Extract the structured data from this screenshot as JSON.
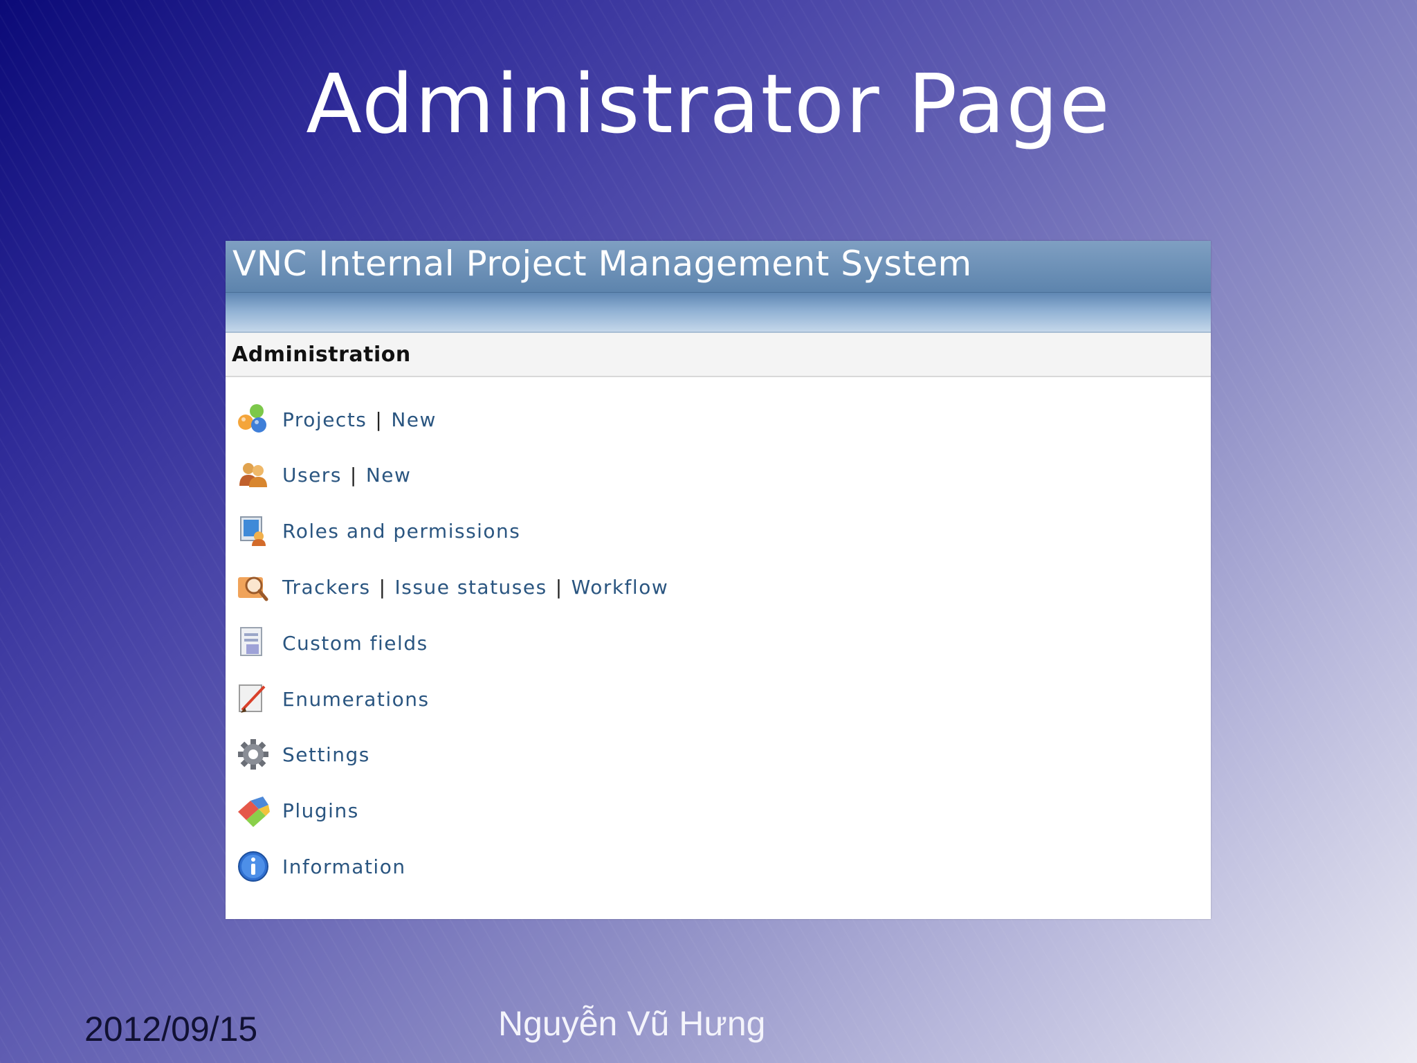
{
  "slide": {
    "title": "Administrator Page",
    "date": "2012/09/15",
    "author": "Nguyễn Vũ Hưng"
  },
  "app": {
    "title": "VNC Internal Project Management System",
    "section_title": "Administration"
  },
  "menu": {
    "projects": {
      "icon": "projects-icon",
      "label": "Projects",
      "new_label": "New"
    },
    "users": {
      "icon": "users-icon",
      "label": "Users",
      "new_label": "New"
    },
    "roles": {
      "icon": "roles-icon",
      "label": "Roles and permissions"
    },
    "trackers": {
      "icon": "trackers-icon",
      "label": "Trackers",
      "issue_statuses": "Issue statuses",
      "workflow": "Workflow"
    },
    "custom_fields": {
      "icon": "custom-fields-icon",
      "label": "Custom fields"
    },
    "enumerations": {
      "icon": "enumerations-icon",
      "label": "Enumerations"
    },
    "settings": {
      "icon": "gear-icon",
      "label": "Settings"
    },
    "plugins": {
      "icon": "plugins-icon",
      "label": "Plugins"
    },
    "information": {
      "icon": "info-icon",
      "label": "Information"
    }
  },
  "colors": {
    "link": "#2a5580",
    "header": "#5d84ad",
    "background_start": "#0b0a78",
    "background_end": "#ececf4"
  }
}
